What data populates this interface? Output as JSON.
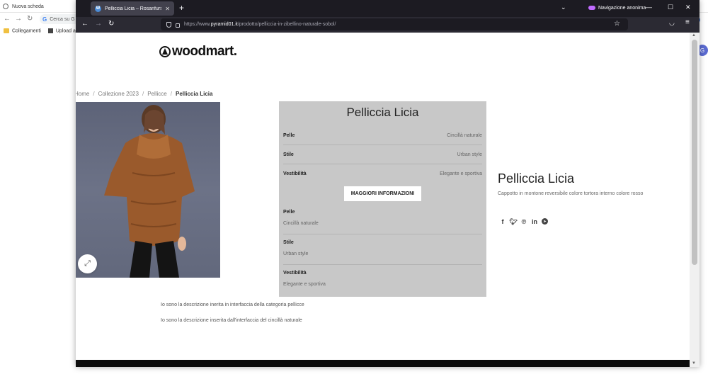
{
  "background_browser": {
    "tab_title": "Nuova scheda",
    "omnibox_text": "Cerca su G",
    "bookmarks": [
      "Collegamenti",
      "Upload an"
    ],
    "avatar_letter": "G"
  },
  "firefox": {
    "tab_title": "Pelliccia Licia – Rosanfurs",
    "tab_icon": "W",
    "private_label": "Navigazione anonima",
    "url_prefix": "https://www.",
    "url_host": "pyramid01.it",
    "url_path": "/prodotto/pelliccia-in-zibellino-naturale-sobol/"
  },
  "site": {
    "logo_text": "woodmart.",
    "breadcrumb": {
      "home": "Home",
      "collection": "Collezione 2023",
      "category": "Pellicce",
      "current": "Pelliccia Licia",
      "separator": "/"
    },
    "panel": {
      "title": "Pelliccia Licia",
      "rows": [
        {
          "key": "Pelle",
          "value": "Cincillà naturale"
        },
        {
          "key": "Stile",
          "value": "Urban style"
        },
        {
          "key": "Vestibilità",
          "value": "Elegante e sportiva"
        }
      ],
      "button_label": "MAGGIORI INFORMAZIONI",
      "stacked_rows": [
        {
          "key": "Pelle",
          "value": "Cincillà naturale"
        },
        {
          "key": "Stile",
          "value": "Urban style"
        },
        {
          "key": "Vestibilità",
          "value": "Elegante e sportiva"
        }
      ]
    },
    "product": {
      "title": "Pelliccia Licia",
      "short_description": "Cappotto in montone reversibile colore tortora interno colore rosso"
    },
    "share_icons": [
      "facebook-icon",
      "twitter-icon",
      "pinterest-icon",
      "linkedin-icon",
      "telegram-icon"
    ],
    "descriptions": [
      "Io sono la descrizione inerita in interfaccia della categoria pellicce",
      "Io sono la descrizione inserita dall'interfaccia del cincillà naturale"
    ]
  },
  "colors": {
    "panel_bg": "#c8c8c8",
    "firefox_dark": "#1c1b22",
    "firefox_toolbar": "#2b2a33",
    "coat_brown": "#9a5a2c"
  }
}
